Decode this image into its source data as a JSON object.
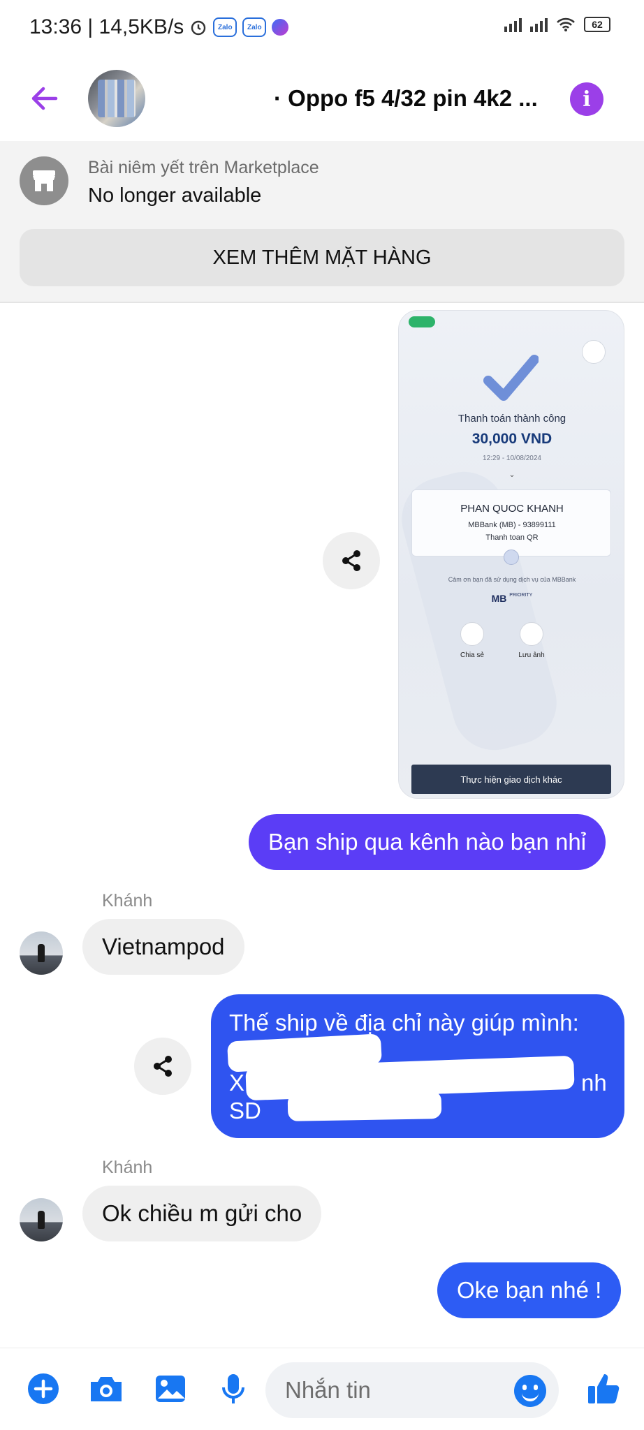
{
  "status_bar": {
    "time_speed": "13:36 | 14,5KB/s",
    "zalo_label": "Zalo",
    "battery": "62"
  },
  "header": {
    "title": "· Oppo f5 4/32 pin 4k2 ..."
  },
  "marketplace": {
    "label": "Bài niêm yết trên Marketplace",
    "status": "No longer available",
    "see_more_button": "XEM THÊM MẶT HÀNG"
  },
  "receipt": {
    "success_text": "Thanh toán thành công",
    "amount": "30,000 VND",
    "datetime": "12:29 - 10/08/2024",
    "recipient_name": "PHAN QUOC KHANH",
    "bank_line": "MBBank (MB) - 93899111",
    "method": "Thanh toan QR",
    "thanks_text": "Cảm ơn bạn đã sử dụng dịch vụ của MBBank",
    "brand": "MB",
    "brand_tag": "PRIORITY",
    "share_label": "Chia sẻ",
    "save_label": "Lưu ảnh",
    "other_transaction_button": "Thực hiện giao dịch khác"
  },
  "messages": [
    {
      "sender": "me",
      "text": "Bạn ship qua kênh nào bạn nhỉ"
    },
    {
      "sender": "Khánh",
      "text": "Vietnampod"
    },
    {
      "sender": "me",
      "text_line1": "Thế ship về địa chỉ này giúp mình:",
      "frag_x": "X",
      "frag_nh": "nh",
      "frag_sd": "SD"
    },
    {
      "sender": "Khánh",
      "text": "Ok chiều m gửi cho"
    },
    {
      "sender": "me",
      "text": "Oke bạn nhé !"
    }
  ],
  "composer": {
    "placeholder": "Nhắn tin"
  },
  "colors": {
    "accent_purple": "#9b3fe8",
    "bubble_purple": "#5b3df6",
    "bubble_blue": "#2d5cf4",
    "messenger_blue": "#1877f2"
  }
}
